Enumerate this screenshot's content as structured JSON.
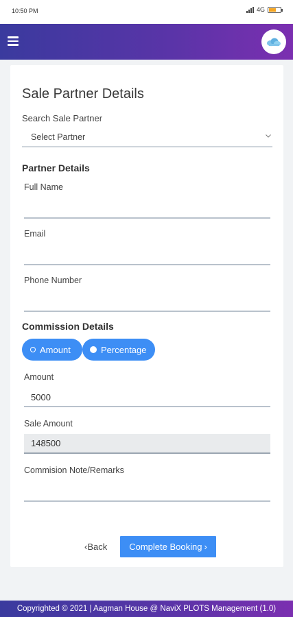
{
  "status_bar": {
    "time": "10:50 PM",
    "network": "4G",
    "battery_level": 0.55
  },
  "header": {
    "menu_icon": "hamburger-menu-icon",
    "avatar_icon": "cloud-logo-icon"
  },
  "form": {
    "title": "Sale Partner Details",
    "search_label": "Search Sale Partner",
    "partner_select": {
      "value": "Select Partner",
      "icon": "chevron-down-icon"
    },
    "partner_details": {
      "heading": "Partner Details",
      "full_name_label": "Full Name",
      "full_name_value": "",
      "email_label": "Email",
      "email_value": "",
      "phone_label": "Phone Number",
      "phone_value": ""
    },
    "commission_details": {
      "heading": "Commission Details",
      "options": [
        "Amount",
        "Percentage"
      ],
      "selected_option": "Percentage",
      "amount_label": "Amount",
      "amount_value": "5000",
      "sale_amount_label": "Sale Amount",
      "sale_amount_value": "148500",
      "remarks_label": "Commision Note/Remarks",
      "remarks_value": ""
    },
    "actions": {
      "back_label": "Back",
      "complete_label": "Complete Booking"
    }
  },
  "footer": {
    "text": "Copyrighted © 2021 | Aagman House @ NaviX PLOTS Management (1.0)"
  },
  "colors": {
    "header_gradient_start": "#3a3a9e",
    "header_gradient_end": "#7b2fb0",
    "accent": "#3d8ef5"
  }
}
